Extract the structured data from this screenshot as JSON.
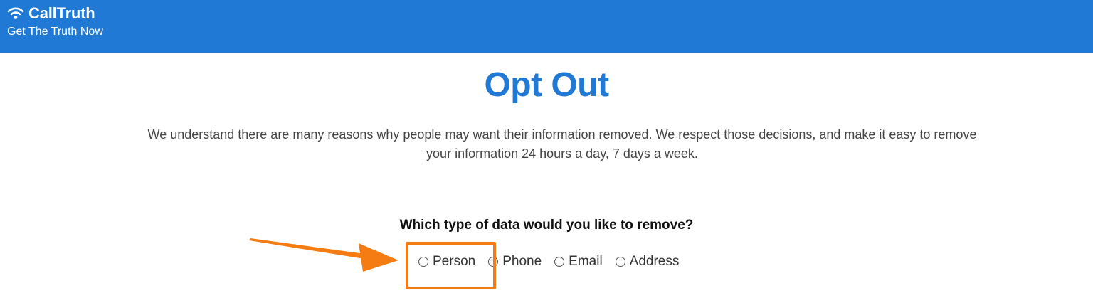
{
  "header": {
    "brand": "CallTruth",
    "tagline": "Get The Truth Now",
    "logo_icon": "wifi-icon",
    "background": "#2079d4"
  },
  "main": {
    "title": "Opt Out",
    "intro": "We understand there are many reasons why people may want their information removed. We respect those decisions, and make it easy to remove your information 24 hours a day, 7 days a week.",
    "question": "Which type of data would you like to remove?",
    "options": [
      {
        "label": "Person",
        "selected": false
      },
      {
        "label": "Phone",
        "selected": false
      },
      {
        "label": "Email",
        "selected": false
      },
      {
        "label": "Address",
        "selected": false
      }
    ]
  },
  "annotation": {
    "highlight_color": "#f47c12",
    "arrow_icon": "arrow-right-icon",
    "highlighted_option": "Person"
  }
}
